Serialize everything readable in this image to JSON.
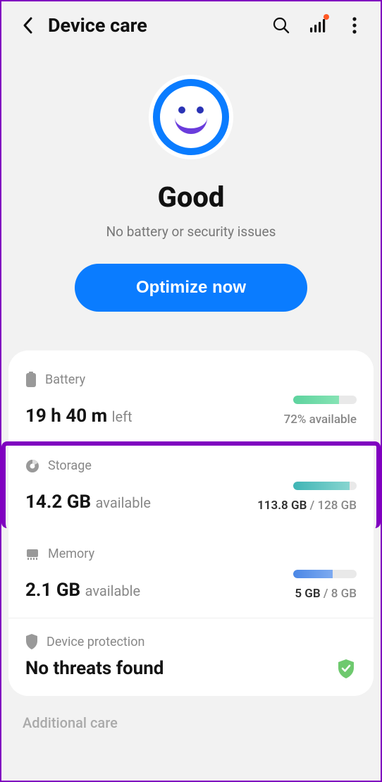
{
  "header": {
    "title": "Device care"
  },
  "hero": {
    "status": "Good",
    "subtitle": "No battery or security issues",
    "button": "Optimize now"
  },
  "battery": {
    "label": "Battery",
    "value": "19 h 40 m",
    "suffix": "left",
    "pct": "72% available"
  },
  "storage": {
    "label": "Storage",
    "value": "14.2 GB",
    "suffix": "available",
    "used": "113.8 GB",
    "total": "128 GB"
  },
  "memory": {
    "label": "Memory",
    "value": "2.1 GB",
    "suffix": "available",
    "used": "5 GB",
    "total": "8 GB"
  },
  "protection": {
    "label": "Device protection",
    "status": "No threats found"
  },
  "additional": {
    "label": "Additional care"
  }
}
